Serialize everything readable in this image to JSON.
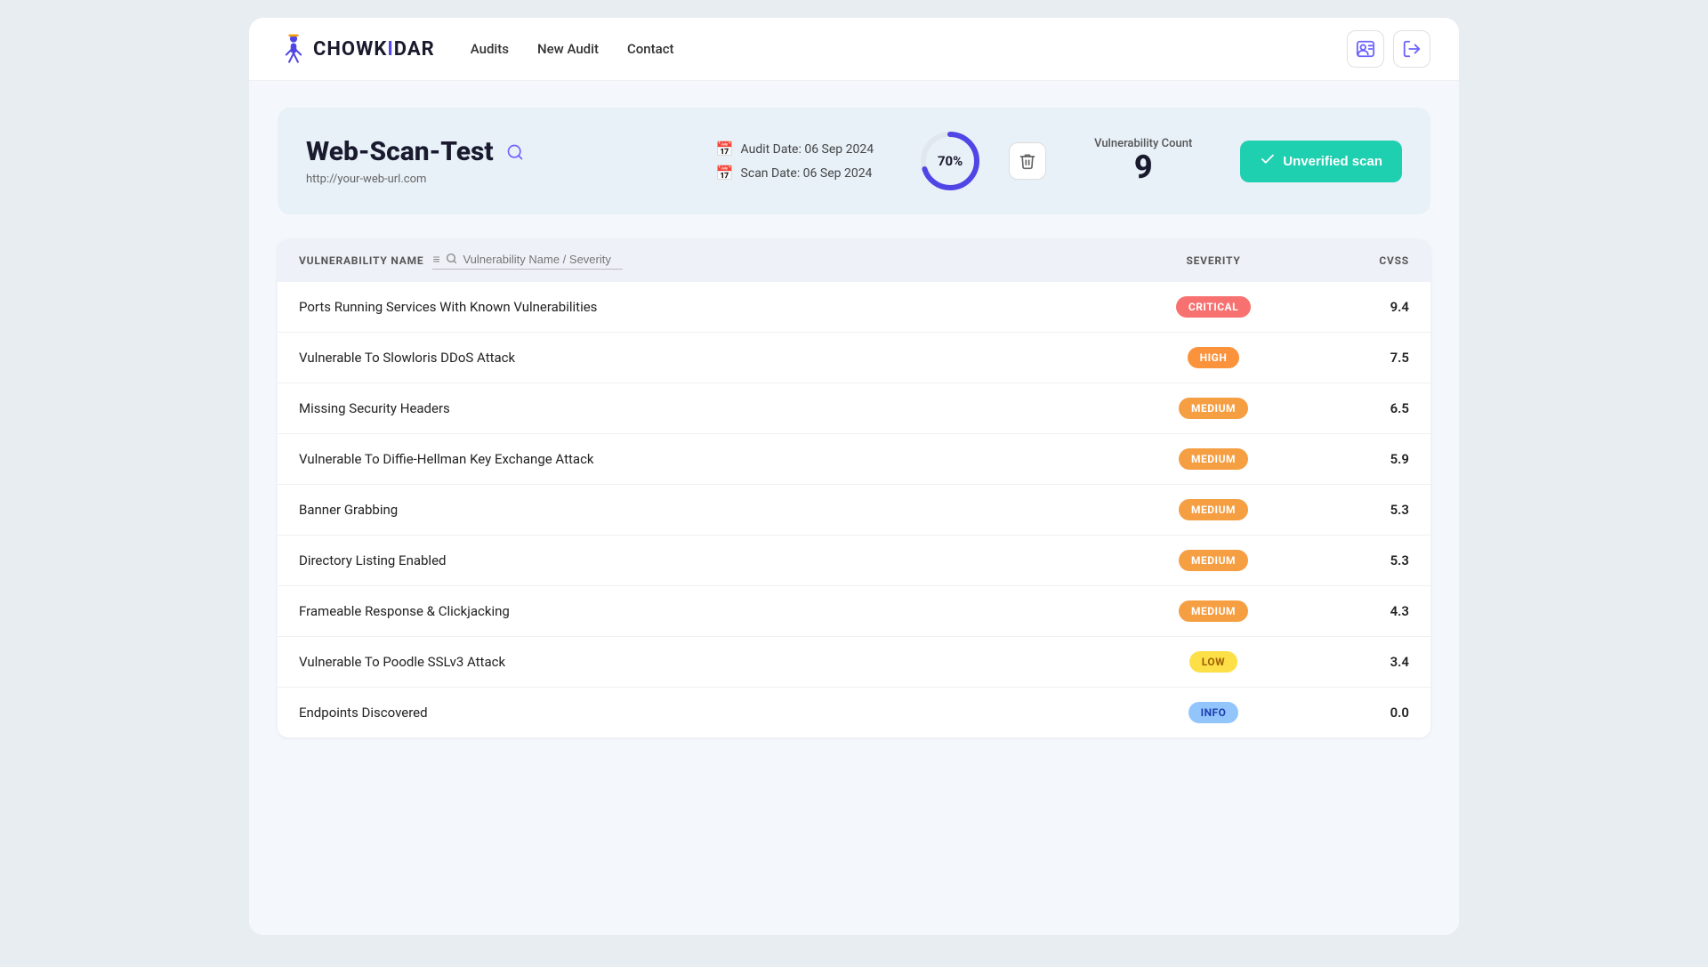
{
  "navbar": {
    "logo_text_left": "CHOWK",
    "logo_text_right": "DAR",
    "links": [
      {
        "label": "Audits",
        "href": "#"
      },
      {
        "label": "New Audit",
        "href": "#"
      },
      {
        "label": "Contact",
        "href": "#"
      }
    ],
    "btn_profile_icon": "👤",
    "btn_logout_icon": "→"
  },
  "header": {
    "scan_title": "Web-Scan-Test",
    "scan_url": "http://your-web-url.com",
    "audit_date_label": "Audit Date: 06 Sep 2024",
    "scan_date_label": "Scan Date: 06 Sep 2024",
    "progress_pct": "70%",
    "progress_value": 70,
    "vuln_count_label": "Vulnerability Count",
    "vuln_count": "9",
    "unverified_label": "Unverified scan"
  },
  "table": {
    "col_name": "VULNERABILITY NAME",
    "col_severity": "SEVERITY",
    "col_cvss": "CVSS",
    "search_placeholder": "Vulnerability Name / Severity",
    "rows": [
      {
        "name": "Ports Running Services With Known Vulnerabilities",
        "severity": "CRITICAL",
        "severity_class": "badge-critical",
        "cvss": "9.4"
      },
      {
        "name": "Vulnerable To Slowloris DDoS Attack",
        "severity": "HIGH",
        "severity_class": "badge-high",
        "cvss": "7.5"
      },
      {
        "name": "Missing Security Headers",
        "severity": "MEDIUM",
        "severity_class": "badge-medium",
        "cvss": "6.5"
      },
      {
        "name": "Vulnerable To Diffie-Hellman Key Exchange Attack",
        "severity": "MEDIUM",
        "severity_class": "badge-medium",
        "cvss": "5.9"
      },
      {
        "name": "Banner Grabbing",
        "severity": "MEDIUM",
        "severity_class": "badge-medium",
        "cvss": "5.3"
      },
      {
        "name": "Directory Listing Enabled",
        "severity": "MEDIUM",
        "severity_class": "badge-medium",
        "cvss": "5.3"
      },
      {
        "name": "Frameable Response & Clickjacking",
        "severity": "MEDIUM",
        "severity_class": "badge-medium",
        "cvss": "4.3"
      },
      {
        "name": "Vulnerable To Poodle SSLv3 Attack",
        "severity": "LOW",
        "severity_class": "badge-low",
        "cvss": "3.4"
      },
      {
        "name": "Endpoints Discovered",
        "severity": "INFO",
        "severity_class": "badge-info",
        "cvss": "0.0"
      }
    ]
  }
}
